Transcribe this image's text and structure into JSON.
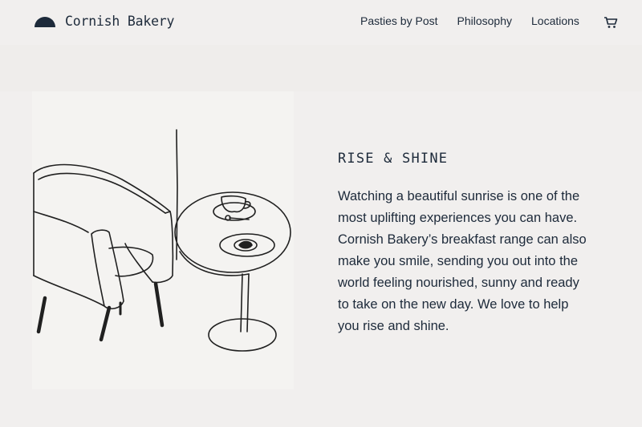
{
  "header": {
    "brand": "Cornish Bakery",
    "logo_icon": "half-sun-logo",
    "nav": [
      {
        "label": "Pasties by Post"
      },
      {
        "label": "Philosophy"
      },
      {
        "label": "Locations"
      }
    ],
    "cart_icon": "cart-icon"
  },
  "main": {
    "illustration_subject": "armchair-and-cafe-table-sketch",
    "heading": "RISE & SHINE",
    "body": "Watching a beautiful sunrise is one of the most uplifting experiences you can have. Cornish Bakery’s breakfast range can also make you smile, sending you out into the world feeling nourished, sunny and ready to take on the new day. We love to help you rise and shine."
  },
  "colors": {
    "background": "#f1efee",
    "text": "#1d2a3a",
    "illustration_background": "#f4f3f1"
  }
}
